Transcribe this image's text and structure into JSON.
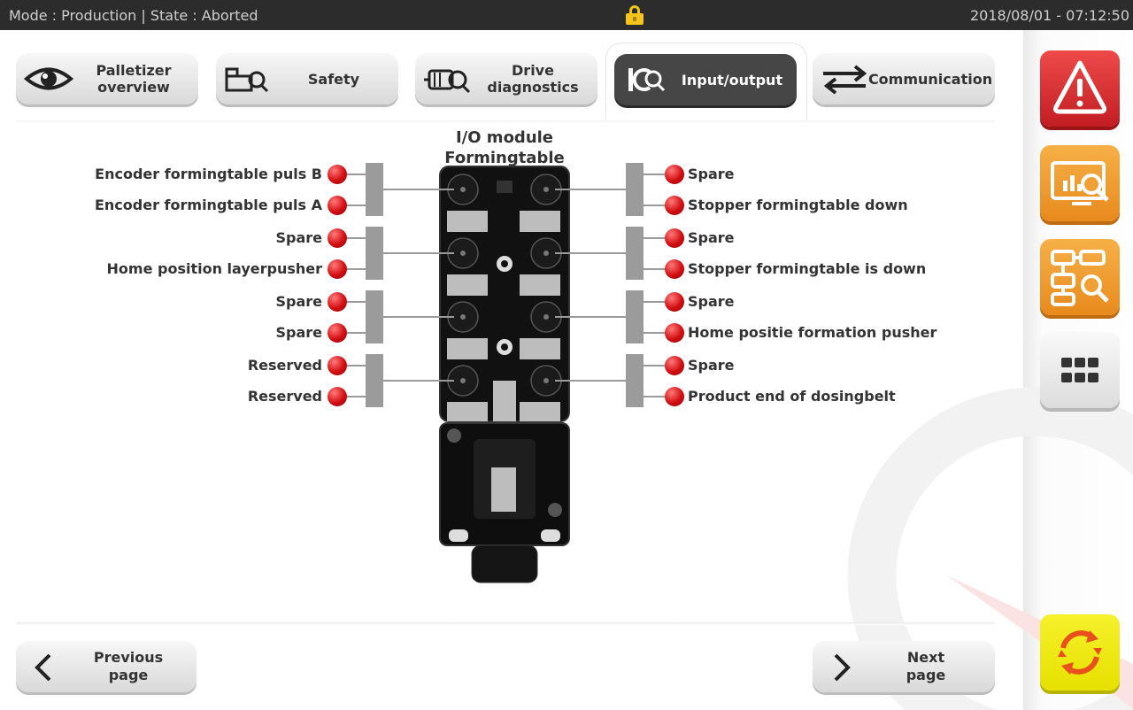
{
  "status_bar": {
    "mode_state": "Mode : Production | State : Aborted",
    "datetime": "2018/08/01 - 07:12:50"
  },
  "tabs": [
    {
      "label": "Palletizer\noverview",
      "icon": "eye-icon"
    },
    {
      "label": "Safety",
      "icon": "safety-inspect-icon"
    },
    {
      "label": "Drive\ndiagnostics",
      "icon": "motor-inspect-icon"
    },
    {
      "label": "Input/output",
      "icon": "io-inspect-icon",
      "active": true
    },
    {
      "label": "Communication",
      "icon": "exchange-arrows-icon"
    }
  ],
  "module": {
    "title_line1": "I/O module",
    "title_line2": "Formingtable"
  },
  "inputs_left": [
    "Encoder formingtable puls B",
    "Encoder formingtable puls A",
    "Spare",
    "Home position layerpusher",
    "Spare",
    "Spare",
    "Reserved",
    "Reserved"
  ],
  "inputs_right": [
    "Spare",
    "Stopper formingtable down",
    "Spare",
    "Stopper formingtable is down",
    "Spare",
    "Home positie formation pusher",
    "Spare",
    "Product end of dosingbelt"
  ],
  "led_color": "#d30e12",
  "footer": {
    "previous_label": "Previous\npage",
    "next_label": "Next\npage"
  },
  "side_buttons": [
    {
      "name": "alarm",
      "icon": "warning-triangle-icon",
      "color": "#d9262b"
    },
    {
      "name": "dashboard",
      "icon": "monitor-chart-inspect-icon",
      "color": "#ee9a2a"
    },
    {
      "name": "flowchart",
      "icon": "flowchart-inspect-icon",
      "color": "#ee9a2a"
    },
    {
      "name": "menu",
      "icon": "grid-dots-icon",
      "color": "#e9e9e9"
    },
    {
      "name": "reset",
      "icon": "rotate-arrows-icon",
      "color": "#f0ea12"
    }
  ]
}
